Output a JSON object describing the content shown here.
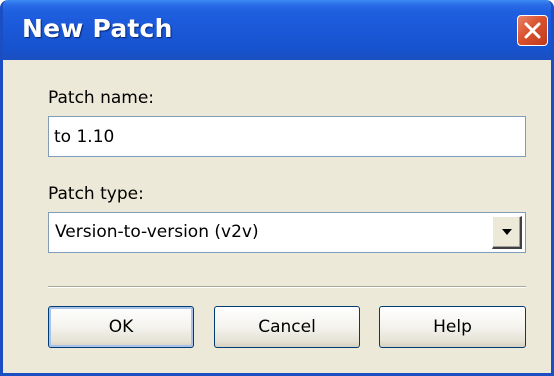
{
  "window": {
    "title": "New Patch",
    "close_icon": "close-icon"
  },
  "form": {
    "patch_name_label": "Patch name:",
    "patch_name_value": "to 1.10",
    "patch_type_label": "Patch type:",
    "patch_type_value": "Version-to-version (v2v)",
    "dropdown_icon": "chevron-down-icon"
  },
  "buttons": {
    "ok_label": "OK",
    "cancel_label": "Cancel",
    "help_label": "Help"
  },
  "colors": {
    "titlebar": "#1a58d8",
    "dialog_background": "#ece9d8",
    "close_button": "#d9532f",
    "button_border": "#003c74"
  }
}
